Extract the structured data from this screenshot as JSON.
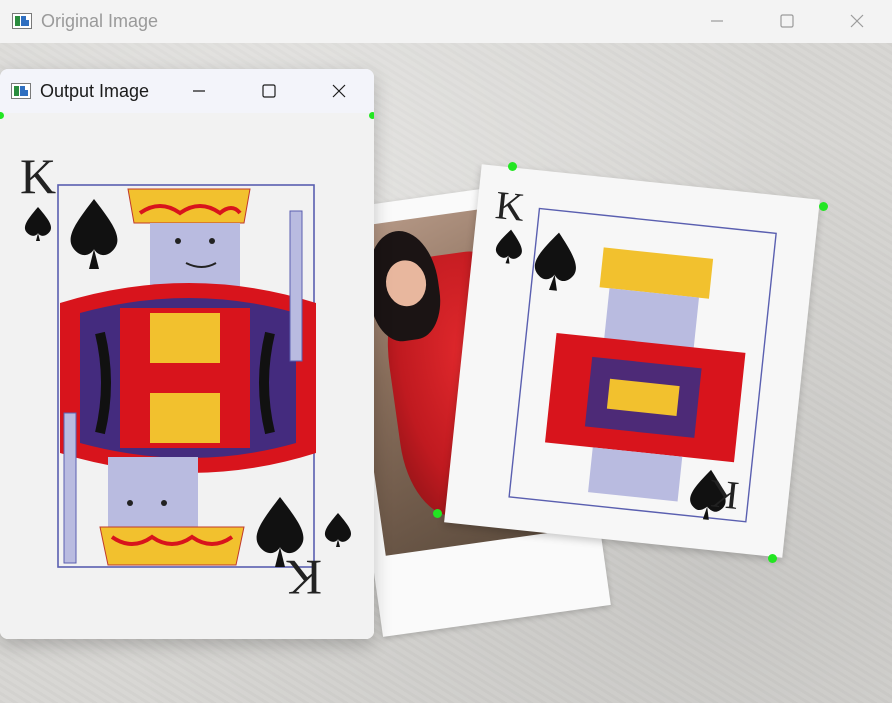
{
  "original_window": {
    "title": "Original Image",
    "controls": {
      "minimize": "—",
      "maximize": "☐",
      "close": "✕"
    }
  },
  "output_window": {
    "title": "Output Image",
    "controls": {
      "minimize": "—",
      "maximize": "☐",
      "close": "✕"
    }
  },
  "card": {
    "rank": "K",
    "suit_icon": "spade-icon"
  },
  "colors": {
    "marker": "#22e622",
    "card_red": "#d8141c",
    "card_gold": "#f2c12e",
    "card_blue": "#2a2f8f"
  }
}
